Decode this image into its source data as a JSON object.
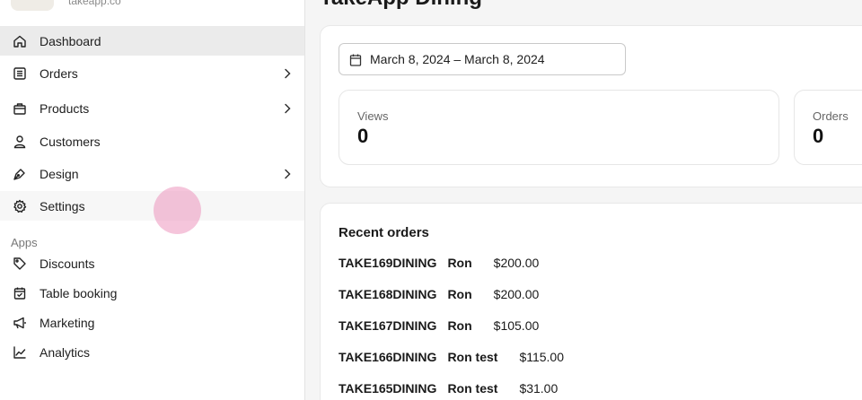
{
  "store": {
    "subtitle": "takeapp.co"
  },
  "sidebar": {
    "items": [
      {
        "label": "Dashboard",
        "icon": "home-icon"
      },
      {
        "label": "Orders",
        "icon": "orders-icon"
      },
      {
        "label": "Products",
        "icon": "products-icon"
      },
      {
        "label": "Customers",
        "icon": "customers-icon"
      },
      {
        "label": "Design",
        "icon": "design-icon"
      },
      {
        "label": "Settings",
        "icon": "gear-icon"
      }
    ],
    "apps_heading": "Apps",
    "apps": [
      {
        "label": "Discounts",
        "icon": "tag-icon"
      },
      {
        "label": "Table booking",
        "icon": "calendar-check-icon"
      },
      {
        "label": "Marketing",
        "icon": "megaphone-icon"
      },
      {
        "label": "Analytics",
        "icon": "chart-line-icon"
      }
    ]
  },
  "main": {
    "title": "TakeApp Dining",
    "date_range": "March 8, 2024 – March 8, 2024",
    "stats": [
      {
        "label": "Views",
        "value": "0"
      },
      {
        "label": "Orders",
        "value": "0"
      }
    ],
    "recent_orders": {
      "title": "Recent orders",
      "rows": [
        {
          "id": "TAKE169DINING",
          "name": "Ron",
          "amount": "$200.00"
        },
        {
          "id": "TAKE168DINING",
          "name": "Ron",
          "amount": "$200.00"
        },
        {
          "id": "TAKE167DINING",
          "name": "Ron",
          "amount": "$105.00"
        },
        {
          "id": "TAKE166DINING",
          "name": "Ron test",
          "amount": "$115.00"
        },
        {
          "id": "TAKE165DINING",
          "name": "Ron test",
          "amount": "$31.00"
        }
      ]
    }
  },
  "colors": {
    "active_nav": "#ebebeb",
    "touch_indicator": "#ec96be"
  }
}
